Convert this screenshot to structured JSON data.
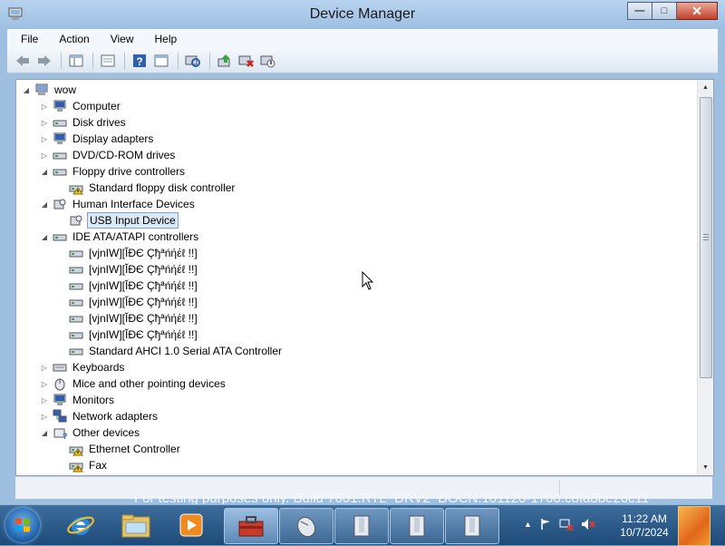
{
  "window": {
    "title": "Device Manager",
    "controls": {
      "minimize": "—",
      "maximize": "□",
      "close": "✕"
    }
  },
  "menu": [
    "File",
    "Action",
    "View",
    "Help"
  ],
  "toolbar": {
    "buttons": [
      "back-arrow-icon",
      "forward-arrow-icon",
      "show-hide-tree-icon",
      "properties-icon",
      "help-icon",
      "view-icon",
      "scan-hardware-icon",
      "update-driver-icon",
      "uninstall-icon",
      "disable-device-icon"
    ]
  },
  "tree": {
    "root": "wow",
    "nodes": [
      {
        "label": "Computer",
        "expanded": false
      },
      {
        "label": "Disk drives",
        "expanded": false
      },
      {
        "label": "Display adapters",
        "expanded": false
      },
      {
        "label": "DVD/CD-ROM drives",
        "expanded": false
      },
      {
        "label": "Floppy drive controllers",
        "expanded": true
      },
      {
        "label": "Standard floppy disk controller",
        "child": true,
        "warning": true
      },
      {
        "label": "Human Interface Devices",
        "expanded": true
      },
      {
        "label": "USB Input Device",
        "child": true,
        "selected": true
      },
      {
        "label": "IDE ATA/ATAPI controllers",
        "expanded": true
      },
      {
        "label": "[vjnIW][ĬĐЄ Çђªńήέℓ !!]",
        "child": true
      },
      {
        "label": "[vjnIW][ĬĐЄ Çђªńήέℓ !!]",
        "child": true
      },
      {
        "label": "[vjnIW][ĬĐЄ Çђªńήέℓ !!]",
        "child": true
      },
      {
        "label": "[vjnIW][ĬĐЄ Çђªńήέℓ !!]",
        "child": true
      },
      {
        "label": "[vjnIW][ĬĐЄ Çђªńήέℓ !!]",
        "child": true
      },
      {
        "label": "[vjnIW][ĬĐЄ Çђªńήέℓ !!]",
        "child": true
      },
      {
        "label": "Standard AHCI 1.0 Serial ATA Controller",
        "child": true
      },
      {
        "label": "Keyboards",
        "expanded": false
      },
      {
        "label": "Mice and other pointing devices",
        "expanded": false
      },
      {
        "label": "Monitors",
        "expanded": false
      },
      {
        "label": "Network adapters",
        "expanded": false
      },
      {
        "label": "Other devices",
        "expanded": true
      },
      {
        "label": "Ethernet Controller",
        "child": true,
        "warning": true
      },
      {
        "label": "Fax",
        "child": true,
        "warning": true
      }
    ]
  },
  "watermark": "For testing purposes only. Build 7601.RTL_DRV2_DOCN.101120-1700.c8fa8be26c11",
  "taskbar": {
    "pinned": [
      "internet-explorer-icon",
      "explorer-folder-icon",
      "media-player-icon"
    ],
    "tasks": [
      "device-manager-toolbox-icon",
      "mouse-icon",
      "window-app-icon",
      "window-app-icon",
      "window-app-icon"
    ],
    "clock": {
      "time": "11:22 AM",
      "date": "10/7/2024"
    }
  },
  "colors": {
    "selection": "#dce9f7",
    "warning": "#f0c419",
    "accent": "#1e4a78"
  }
}
